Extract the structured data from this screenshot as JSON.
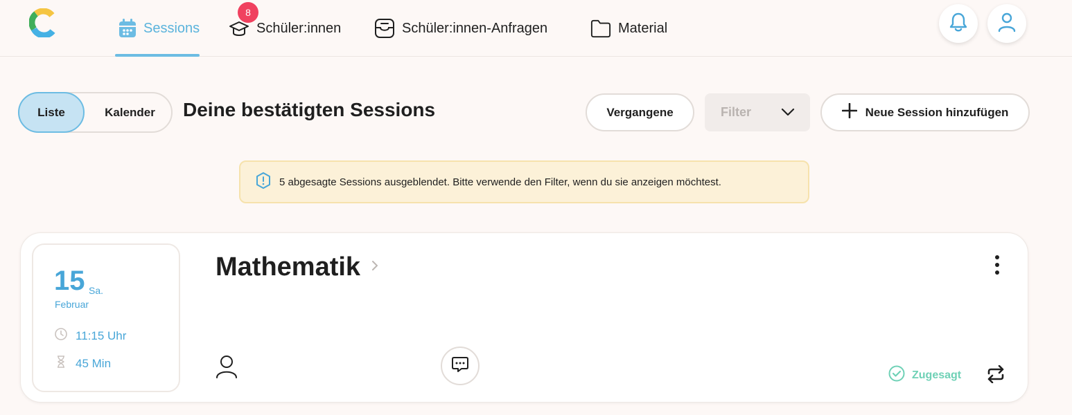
{
  "nav": {
    "items": [
      {
        "label": "Sessions",
        "icon": "calendar-icon",
        "active": true
      },
      {
        "label": "Schüler:innen",
        "icon": "graduation-cap-icon",
        "badge": "8"
      },
      {
        "label": "Schüler:innen-Anfragen",
        "icon": "inbox-icon"
      },
      {
        "label": "Material",
        "icon": "folder-icon"
      }
    ],
    "notifications_icon": "bell-icon",
    "profile_icon": "user-icon",
    "accent_color": "#6cbce3"
  },
  "view_toggle": {
    "list_label": "Liste",
    "calendar_label": "Kalender",
    "selected": "Liste"
  },
  "page_title": "Deine bestätigten Sessions",
  "toolbar": {
    "past_label": "Vergangene",
    "filter_placeholder": "Filter",
    "add_session_label": "Neue Session hinzufügen"
  },
  "banner": {
    "text": "5 abgesagte Sessions ausgeblendet. Bitte verwende den Filter, wenn du sie anzeigen möchtest.",
    "icon": "info-shield-icon"
  },
  "session": {
    "day": "15",
    "weekday": "Sa.",
    "month": "Februar",
    "time": "11:15 Uhr",
    "duration": "45 Min",
    "subject": "Mathematik",
    "status": "Zugesagt",
    "status_color": "#6fd1b6"
  }
}
